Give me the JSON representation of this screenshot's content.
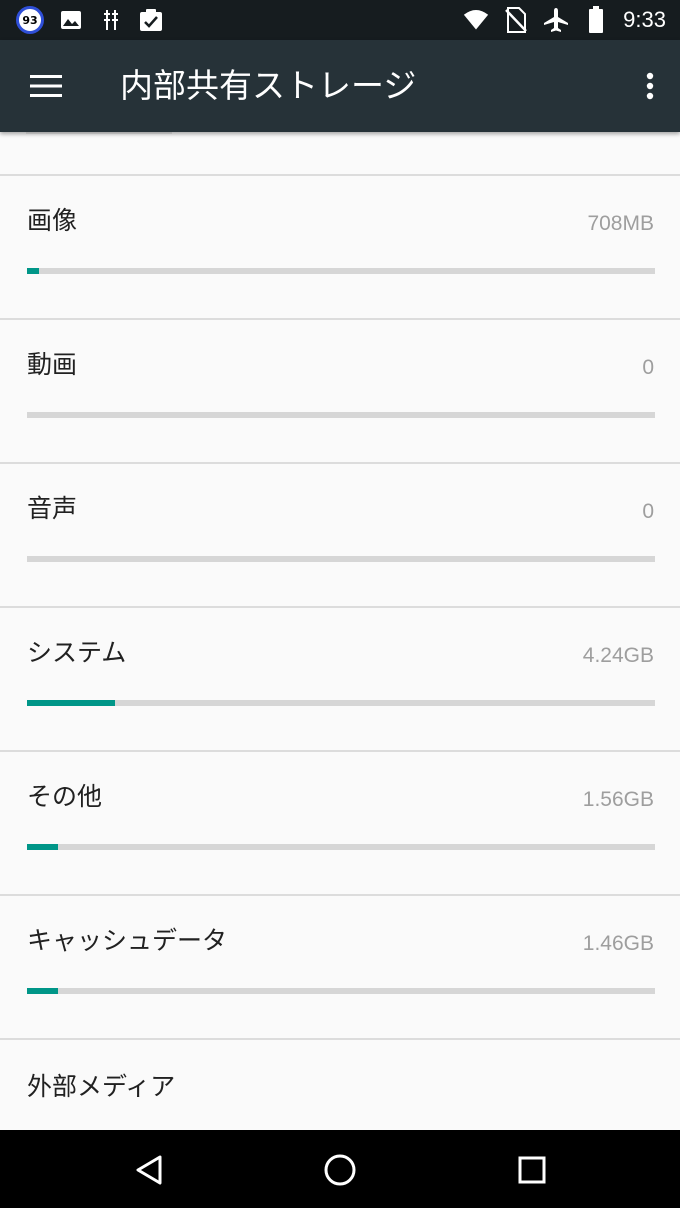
{
  "status_bar": {
    "notification_badge": "93",
    "time": "9:33",
    "left_icons": [
      "image-icon",
      "usb-debug-icon",
      "clipboard-check-icon"
    ],
    "right_icons": [
      "wifi-icon",
      "no-sim-icon",
      "airplane-icon",
      "battery-icon"
    ]
  },
  "toolbar": {
    "title": "内部共有ストレージ",
    "menu_icon": "hamburger-menu-icon",
    "overflow_icon": "more-vert-icon"
  },
  "storage_items": [
    {
      "label": "画像",
      "value": "708MB",
      "usage_fraction": 0.019
    },
    {
      "label": "動画",
      "value": "0",
      "usage_fraction": 0
    },
    {
      "label": "音声",
      "value": "0",
      "usage_fraction": 0
    },
    {
      "label": "システム",
      "value": "4.24GB",
      "usage_fraction": 0.14
    },
    {
      "label": "その他",
      "value": "1.56GB",
      "usage_fraction": 0.05
    },
    {
      "label": "キャッシュデータ",
      "value": "1.46GB",
      "usage_fraction": 0.05
    }
  ],
  "external_media": {
    "label": "外部メディア"
  },
  "colors": {
    "toolbar": "#263238",
    "status_bar": "#161c1f",
    "accent": "#009688",
    "bar_track": "#d6d6d6"
  },
  "nav_bar": {
    "back_icon": "back-triangle-icon",
    "home_icon": "home-circle-icon",
    "recents_icon": "recents-square-icon"
  }
}
